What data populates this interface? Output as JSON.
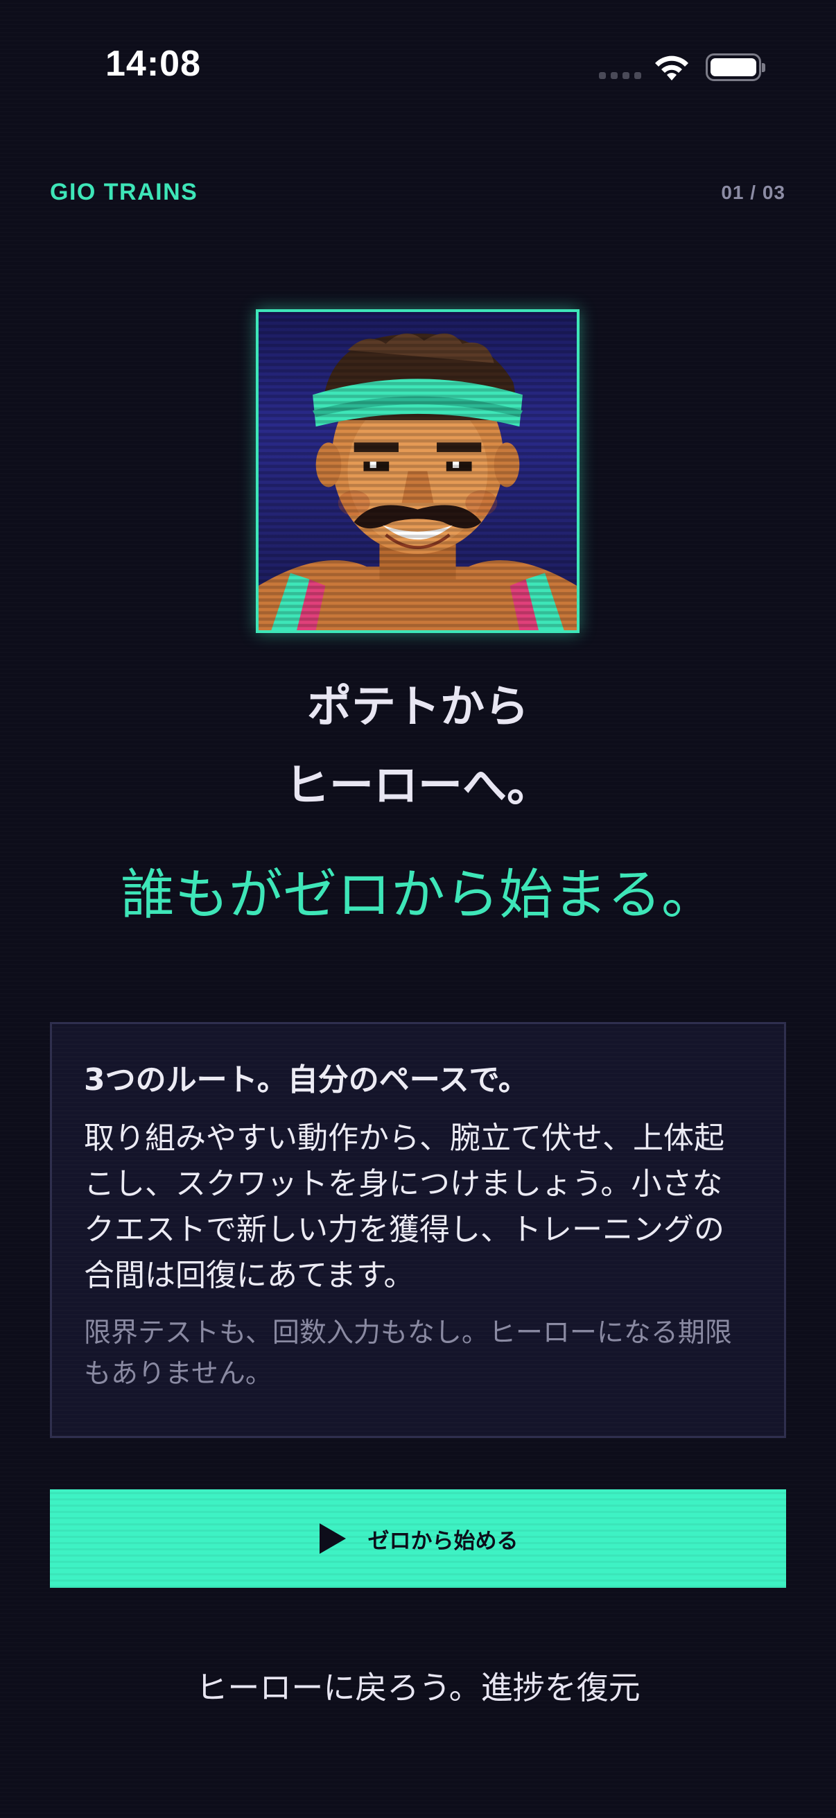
{
  "status_bar": {
    "time": "14:08"
  },
  "header": {
    "brand": "GIO TRAINS",
    "page_counter": "01 / 03"
  },
  "hero": {
    "headline_line1": "ポテトから",
    "headline_line2": "ヒーローへ。",
    "tagline": "誰もがゼロから始まる。"
  },
  "card": {
    "title": "3つのルート。自分のペースで。",
    "body": "取り組みやすい動作から、腕立て伏せ、上体起こし、スクワットを身につけましょう。小さなクエストで新しい力を獲得し、トレーニングの合間は回復にあてます。",
    "note": "限界テストも、回数入力もなし。ヒーローになる期限もありません。"
  },
  "cta": {
    "label": "ゼロから始める"
  },
  "restore_link": "ヒーローに戻ろう。進捗を復元",
  "colors": {
    "accent": "#3ee6b8",
    "background": "#0d0d1a",
    "card": "#14142a"
  }
}
